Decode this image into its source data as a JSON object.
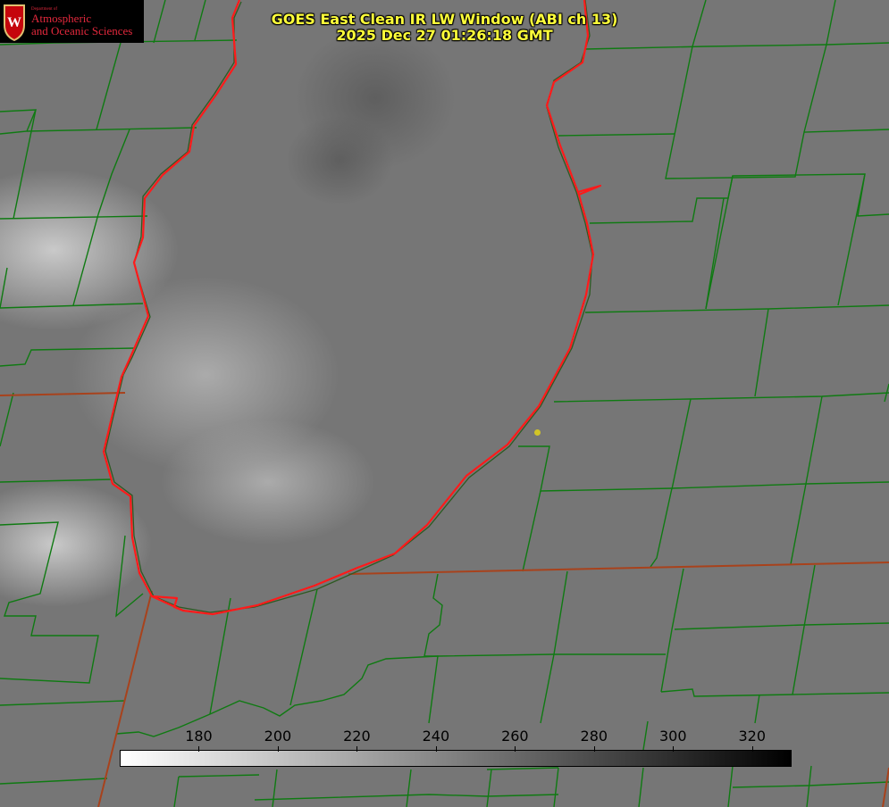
{
  "title": {
    "line1": "GOES East Clean IR LW Window (ABI ch 13)",
    "line2": "2025 Dec 27 01:26:18 GMT"
  },
  "logo": {
    "crest_letter": "W",
    "department": "Department of",
    "line1": "Atmospheric",
    "line2": "and Oceanic Sciences"
  },
  "colorbar": {
    "min": 160,
    "max": 330,
    "ticks": [
      180,
      200,
      220,
      240,
      260,
      280,
      300,
      320
    ],
    "gradient_start": "#ffffff",
    "gradient_end": "#000000"
  },
  "colors": {
    "background_gray": "#767676",
    "county_lines": "#0f7a12",
    "state_lines": "#a8421c",
    "lake_outline": "#ff1a1a",
    "title_text": "#ffff3a",
    "station_marker": "#d2c526",
    "logo_text": "#e2283c"
  }
}
